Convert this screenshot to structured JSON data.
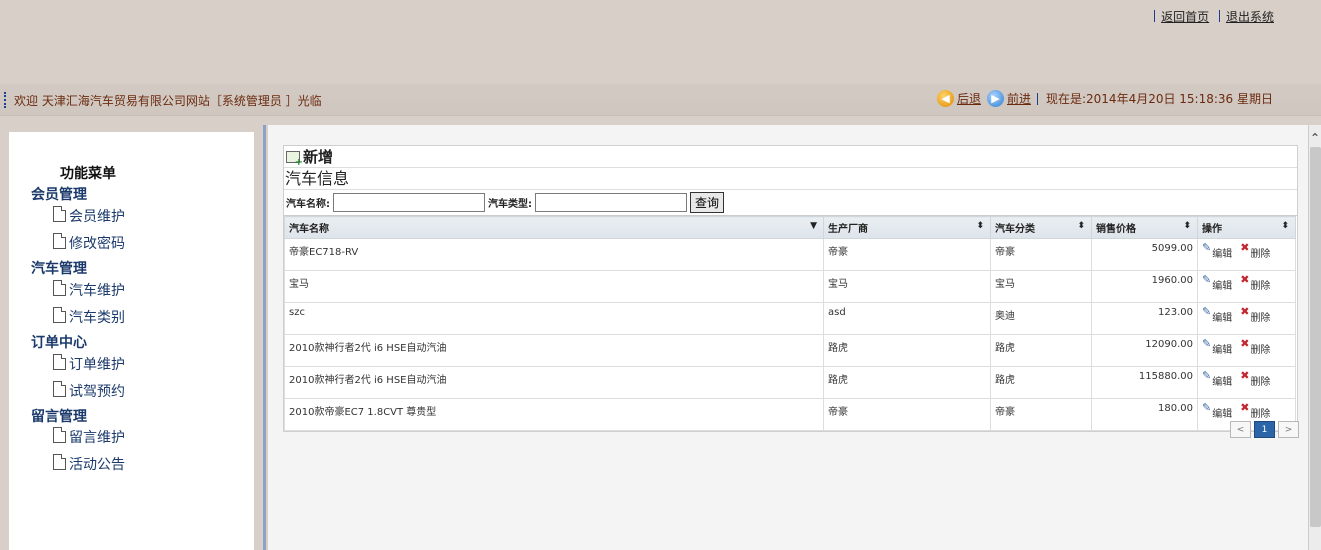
{
  "top_links": {
    "home": "返回首页",
    "logout": "退出系统"
  },
  "welcome": "欢迎 天津汇海汽车贸易有限公司网站［系统管理员 ］光临",
  "nav": {
    "back": "后退",
    "forward": "前进",
    "datetime": "现在是:2014年4月20日 15:18:36 星期日"
  },
  "menu": {
    "title": "功能菜单",
    "groups": [
      {
        "label": "会员管理",
        "items": [
          "会员维护",
          "修改密码"
        ]
      },
      {
        "label": "汽车管理",
        "items": [
          "汽车维护",
          "汽车类别"
        ]
      },
      {
        "label": "订单中心",
        "items": [
          "订单维护",
          "试驾预约"
        ]
      },
      {
        "label": "留言管理",
        "items": [
          "留言维护",
          "活动公告"
        ]
      }
    ]
  },
  "main": {
    "add_label": "新增",
    "section_title": "汽车信息",
    "search": {
      "name_label": "汽车名称:",
      "type_label": "汽车类型:",
      "name_value": "",
      "type_value": "",
      "button": "查询"
    },
    "columns": [
      "汽车名称",
      "生产厂商",
      "汽车分类",
      "销售价格",
      "操作"
    ],
    "rows": [
      [
        "帝豪EC718-RV",
        "帝豪",
        "帝豪",
        "5099.00"
      ],
      [
        "宝马",
        "宝马",
        "宝马",
        "1960.00"
      ],
      [
        "szc",
        "asd",
        "奥迪",
        "123.00"
      ],
      [
        "2010款神行者2代 i6 HSE自动汽油",
        "路虎",
        "路虎",
        "12090.00"
      ],
      [
        "2010款神行者2代 i6 HSE自动汽油",
        "路虎",
        "路虎",
        "115880.00"
      ],
      [
        "2010款帝豪EC7 1.8CVT 尊贵型",
        "帝豪",
        "帝豪",
        "180.00"
      ]
    ],
    "ops": {
      "edit": "编辑",
      "delete": "删除"
    },
    "pager": {
      "prev": "<",
      "current": "1",
      "next": ">"
    }
  }
}
